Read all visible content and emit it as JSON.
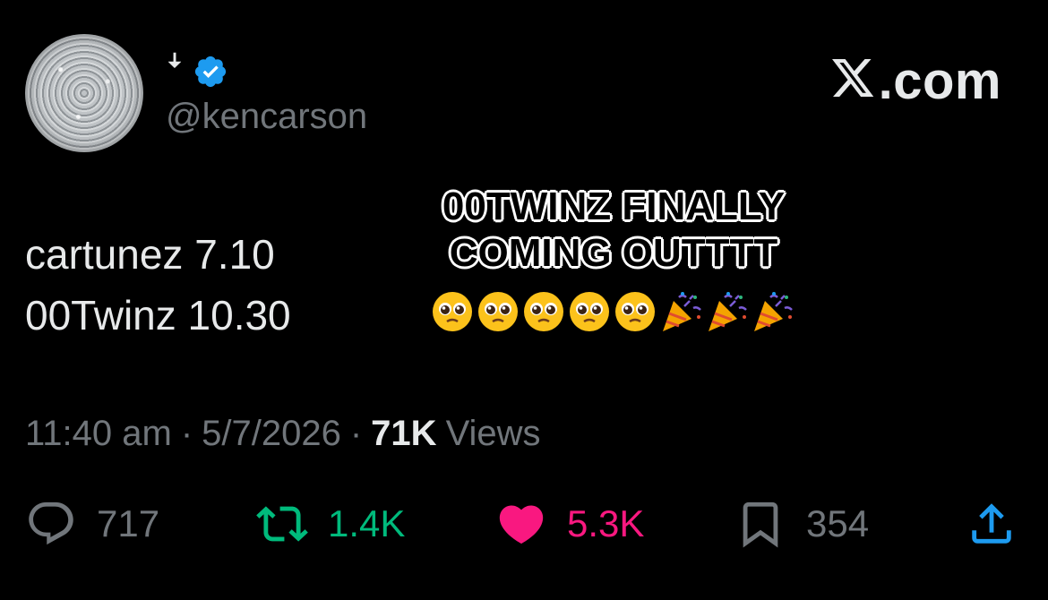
{
  "author": {
    "display_name": "ꜜ",
    "handle": "@kencarson",
    "verified": true,
    "verified_color": "#1d9bf0"
  },
  "brand": {
    "label": ".com",
    "logo_icon": "x-logo-icon"
  },
  "tweet": {
    "lines": [
      "cartunez 7.10",
      "00Twinz 10.30"
    ]
  },
  "overlay": {
    "lines": [
      "00TWINZ FINALLY",
      "COMING OUTTTT"
    ],
    "emojis": [
      "pleading-face",
      "pleading-face",
      "pleading-face",
      "pleading-face",
      "pleading-face",
      "party-popper",
      "party-popper",
      "party-popper"
    ]
  },
  "meta": {
    "time": "11:40 am",
    "sep1": "·",
    "date": "5/7/2026",
    "sep2": "·",
    "views_count": "71K",
    "views_label": "Views"
  },
  "actions": {
    "replies": {
      "count": "717",
      "color": "#71767b",
      "icon": "reply-icon"
    },
    "reposts": {
      "count": "1.4K",
      "color": "#00ba7c",
      "icon": "repost-icon"
    },
    "likes": {
      "count": "5.3K",
      "color": "#f91880",
      "icon": "heart-icon"
    },
    "bookmarks": {
      "count": "354",
      "color": "#71767b",
      "icon": "bookmark-icon"
    },
    "share": {
      "icon": "share-icon",
      "color": "#1d9bf0"
    }
  }
}
